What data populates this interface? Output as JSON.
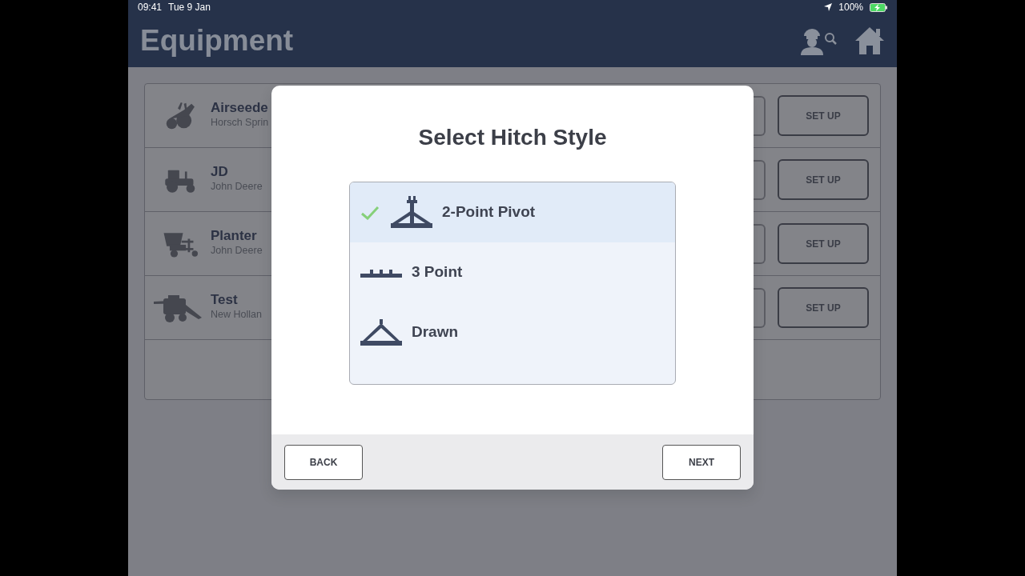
{
  "status_bar": {
    "time": "09:41",
    "date": "Tue 9 Jan",
    "battery": "100%"
  },
  "header": {
    "title": "Equipment"
  },
  "equipment": [
    {
      "kind": "airseeder",
      "name": "Airseede",
      "maker": "Horsch Sprin",
      "button": "SET UP"
    },
    {
      "kind": "tractor",
      "name": "JD",
      "maker": "John Deere",
      "button": "SET UP"
    },
    {
      "kind": "planter",
      "name": "Planter",
      "maker": "John Deere",
      "button": "SET UP"
    },
    {
      "kind": "harvester",
      "name": "Test",
      "maker": "New Hollan",
      "button": "SET UP"
    }
  ],
  "dialog": {
    "title": "Select Hitch Style",
    "options": [
      {
        "kind": "two_point",
        "label": "2-Point Pivot",
        "selected": true
      },
      {
        "kind": "three_point",
        "label": "3 Point",
        "selected": false
      },
      {
        "kind": "drawn",
        "label": "Drawn",
        "selected": false
      }
    ],
    "buttons": {
      "back": "BACK",
      "next": "NEXT"
    }
  }
}
